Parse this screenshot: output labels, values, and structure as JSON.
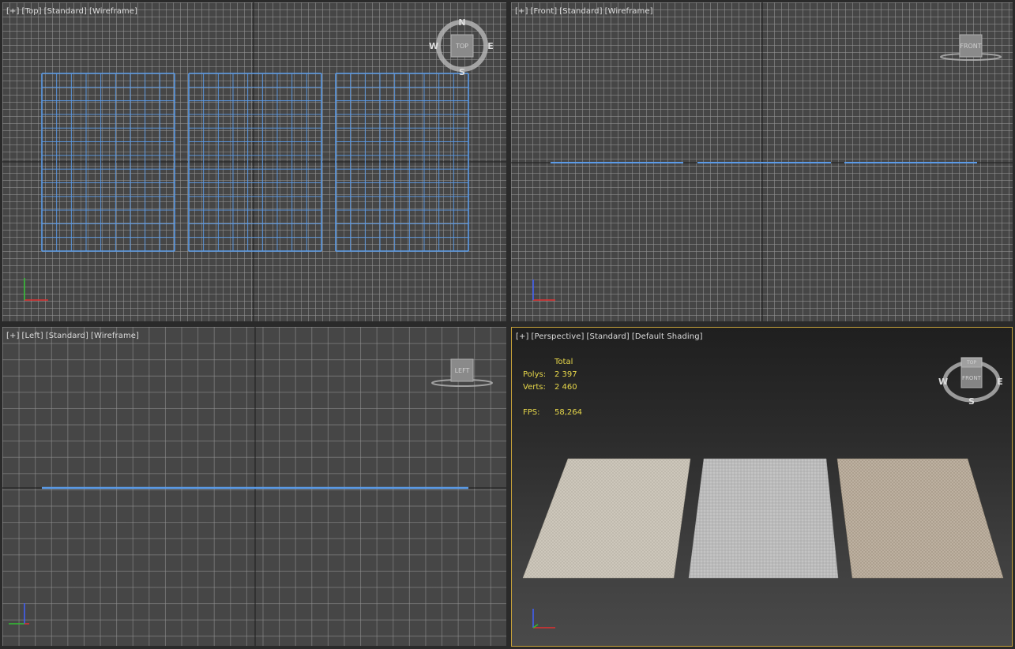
{
  "viewports": {
    "top": {
      "label_parts": [
        "[+]",
        "[Top]",
        "[Standard]",
        "[Wireframe]"
      ],
      "cube_face": "TOP"
    },
    "front": {
      "label_parts": [
        "[+]",
        "[Front]",
        "[Standard]",
        "[Wireframe]"
      ],
      "cube_face": "FRONT"
    },
    "left": {
      "label_parts": [
        "[+]",
        "[Left]",
        "[Standard]",
        "[Wireframe]"
      ],
      "cube_face": "LEFT"
    },
    "perspective": {
      "label_parts": [
        "[+]",
        "[Perspective]",
        "[Standard]",
        "[Default Shading]"
      ],
      "cube_top": "TOP",
      "cube_front": "FRONT",
      "stats": {
        "header": "Total",
        "polys_label": "Polys:",
        "polys_value": "2 397",
        "verts_label": "Verts:",
        "verts_value": "2 460",
        "fps_label": "FPS:",
        "fps_value": "58,264"
      }
    }
  },
  "compass": {
    "n": "N",
    "s": "S",
    "e": "E",
    "w": "W"
  },
  "colors": {
    "wireframe": "#5b9be8",
    "active_border": "#c8a23a",
    "stats_text": "#e8d84a"
  }
}
